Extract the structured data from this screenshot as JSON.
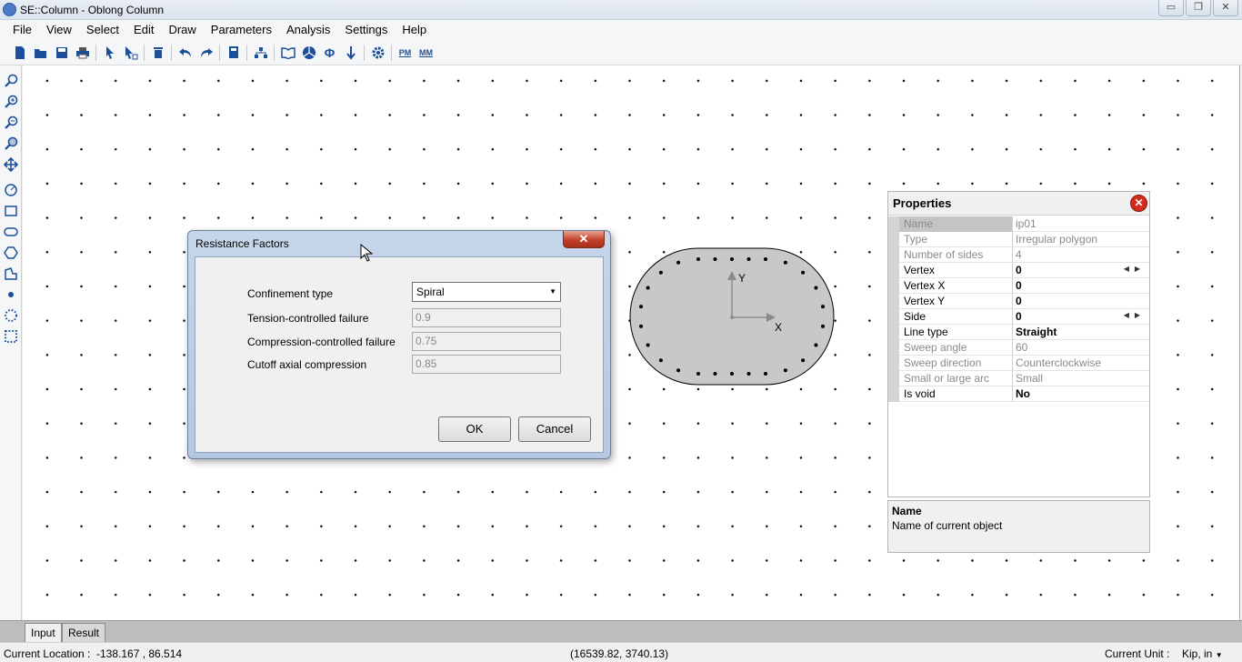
{
  "window": {
    "title": "SE::Column - Oblong Column",
    "minimize": "▭",
    "restore": "❐",
    "close": "✕"
  },
  "menu": [
    "File",
    "View",
    "Select",
    "Edit",
    "Draw",
    "Parameters",
    "Analysis",
    "Settings",
    "Help"
  ],
  "toolbar_icons": [
    "new-icon",
    "open-icon",
    "save-icon",
    "print-icon",
    "select-icon",
    "select-partial-icon",
    "delete-icon",
    "undo-icon",
    "redo-icon",
    "calculator-icon",
    "hierarchy-icon",
    "book-icon",
    "pie-icon",
    "phi-icon",
    "arrow-down-icon",
    "settings-icon",
    "pm-icon",
    "mm-icon"
  ],
  "toolbar_glyphs": {
    "pm": "PM",
    "mm": "MM",
    "phi": "Φ"
  },
  "leftbar_icons": [
    "zoom-fit-icon",
    "zoom-in-icon",
    "zoom-out-icon",
    "zoom-window-icon",
    "pan-icon",
    "circle-tool-icon",
    "rectangle-tool-icon",
    "oval-tool-icon",
    "polygon-tool-icon",
    "irregular-polygon-icon",
    "point-icon",
    "circular-pattern-icon",
    "rectangular-pattern-icon"
  ],
  "shape": {
    "axis_x": "X",
    "axis_y": "Y"
  },
  "dialog": {
    "title": "Resistance Factors",
    "close": "✕",
    "confinement_label": "Confinement type",
    "confinement_value": "Spiral",
    "tension_label": "Tension-controlled failure",
    "tension_value": "0.9",
    "compression_label": "Compression-controlled failure",
    "compression_value": "0.75",
    "cutoff_label": "Cutoff axial compression",
    "cutoff_value": "0.85",
    "ok": "OK",
    "cancel": "Cancel"
  },
  "properties": {
    "title": "Properties",
    "close": "✕",
    "rows": [
      {
        "name": "Name",
        "value": "ip01"
      },
      {
        "name": "Type",
        "value": "Irregular polygon"
      },
      {
        "name": "Number of sides",
        "value": "4"
      },
      {
        "name": "Vertex",
        "value": "0"
      },
      {
        "name": "Vertex X",
        "value": "0"
      },
      {
        "name": "Vertex Y",
        "value": "0"
      },
      {
        "name": "Side",
        "value": "0"
      },
      {
        "name": "Line type",
        "value": "Straight"
      },
      {
        "name": "Sweep angle",
        "value": "60"
      },
      {
        "name": "Sweep direction",
        "value": "Counterclockwise"
      },
      {
        "name": "Small or large arc",
        "value": "Small"
      },
      {
        "name": "Is void",
        "value": "No"
      }
    ],
    "desc_title": "Name",
    "desc_text": "Name of current object"
  },
  "tabs": {
    "input": "Input",
    "result": "Result"
  },
  "status": {
    "location_label": "Current Location :",
    "location_value": "-138.167 , 86.514",
    "coords": "(16539.82, 3740.13)",
    "unit_label": "Current Unit :",
    "unit_value": "Kip, in"
  }
}
